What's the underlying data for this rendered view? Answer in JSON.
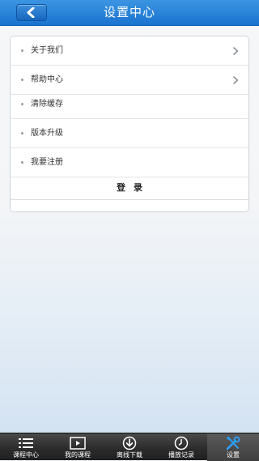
{
  "header": {
    "title": "设置中心",
    "back_icon": "back-arrow-icon"
  },
  "menu": {
    "items": [
      {
        "label": "关于我们",
        "has_arrow": true
      },
      {
        "label": "帮助中心",
        "has_arrow": true
      },
      {
        "label": "清除缓存",
        "has_arrow": false
      },
      {
        "label": "版本升级",
        "has_arrow": false
      },
      {
        "label": "我要注册",
        "has_arrow": false
      }
    ],
    "login_label": "登录"
  },
  "tabbar": {
    "tabs": [
      {
        "label": "课程中心",
        "icon": "list-icon"
      },
      {
        "label": "我的课程",
        "icon": "play-icon"
      },
      {
        "label": "离线下载",
        "icon": "download-icon"
      },
      {
        "label": "播放记录",
        "icon": "clock-icon"
      },
      {
        "label": "设置",
        "icon": "tools-icon"
      }
    ],
    "active_tab": "设置"
  },
  "colors": {
    "header_blue": "#1f7dd6",
    "tabbar_dark": "#2e2e2e",
    "tab_active": "#4a4a4a"
  }
}
